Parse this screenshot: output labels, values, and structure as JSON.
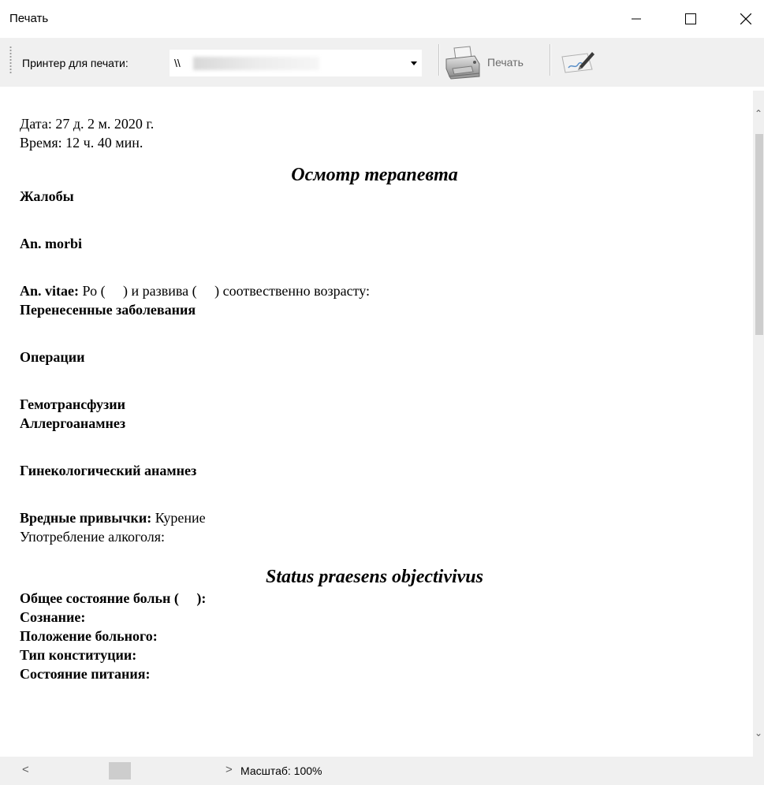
{
  "window": {
    "title": "Печать"
  },
  "toolbar": {
    "printer_label": "Принтер для печати:",
    "printer_value": "\\\\",
    "print_label": "Печать"
  },
  "document": {
    "date": "Дата: 27 д. 2 м. 2020 г.",
    "time": "Время: 12 ч. 40 мин.",
    "section1_title": "Осмотр терапевта",
    "complaints": "Жалобы",
    "an_morbi": "An. morbi",
    "an_vitae_label": "An. vitae:",
    "an_vitae_text": " Ро (     ) и развива (     ) соотвественно возрасту:",
    "prev_diseases": "Перенесенные заболевания",
    "operations": "Операции",
    "hemotransfusions": "Гемотрансфузии",
    "allergo": "Аллергоанамнез",
    "gyn": "Гинекологический анамнез",
    "habits_label": "Вредные привычки:",
    "habits_text": " Курение",
    "alcohol": "Употребление алкоголя:",
    "section2_title": "Status praesens objectivivus",
    "general_state": "Общее состояние больн (     ):",
    "consciousness": "Сознание:",
    "position": "Положение больного:",
    "constitution": "Тип конституции:",
    "nutrition": "Состояние питания:"
  },
  "statusbar": {
    "zoom": "Масштаб: 100%"
  }
}
